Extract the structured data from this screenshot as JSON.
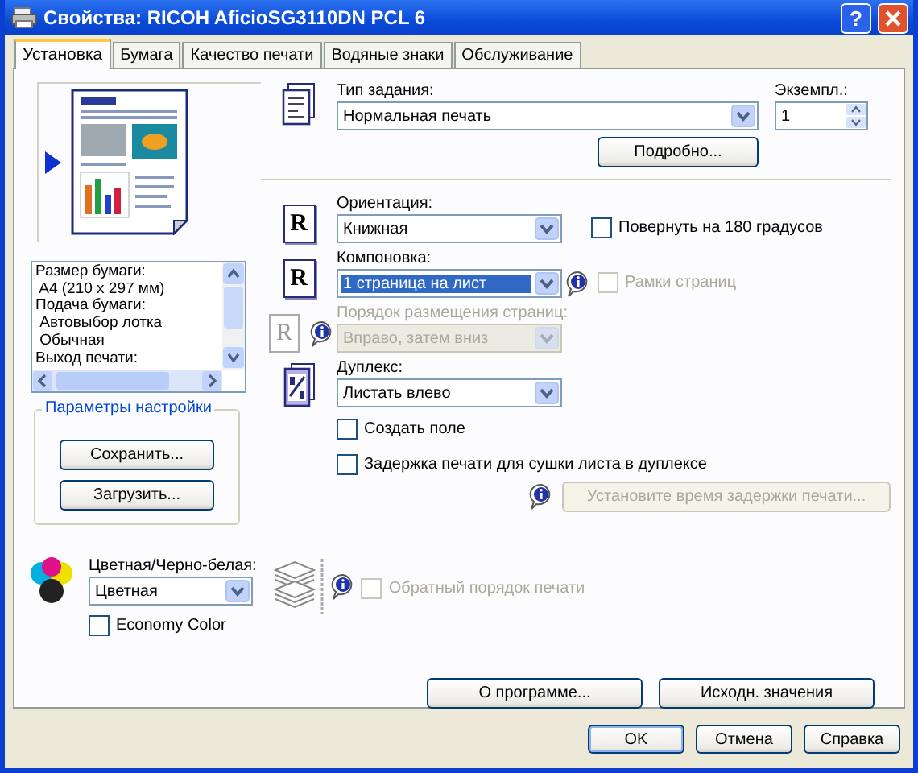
{
  "window": {
    "title": "Свойства: RICOH AficioSG3110DN PCL 6",
    "help_button": "?"
  },
  "tabs": [
    {
      "label": "Установка",
      "selected": true
    },
    {
      "label": "Бумага",
      "selected": false
    },
    {
      "label": "Качество печати",
      "selected": false
    },
    {
      "label": "Водяные знаки",
      "selected": false
    },
    {
      "label": "Обслуживание",
      "selected": false
    }
  ],
  "job_type": {
    "label": "Тип задания:",
    "value": "Нормальная печать"
  },
  "copies": {
    "label": "Экземпл.:",
    "value": "1"
  },
  "details_button": "Подробно...",
  "info_lines": [
    "Размер бумаги:",
    " A4 (210 x 297 мм)",
    "Подача бумаги:",
    " Автовыбор лотка",
    " Обычная",
    "Выход печати:"
  ],
  "orientation": {
    "icon_text": "R",
    "label": "Ориентация:",
    "value": "Книжная",
    "disabled": false,
    "focused": false
  },
  "rotate_180": {
    "label": "Повернуть на 180 градусов",
    "checked": false,
    "disabled": false
  },
  "layout": {
    "icon_text": "R",
    "label": "Компоновка:",
    "value": "1 страница на лист",
    "disabled": false,
    "focused": true
  },
  "page_borders": {
    "label": "Рамки страниц",
    "checked": false,
    "disabled": true
  },
  "page_order": {
    "icon_text": "R",
    "label": "Порядок размещения страниц:",
    "value": "Вправо, затем вниз",
    "disabled": true,
    "focused": false
  },
  "duplex": {
    "label": "Дуплекс:",
    "value": "Листать влево",
    "disabled": false,
    "focused": false
  },
  "create_margin": {
    "label": "Создать поле",
    "checked": false,
    "disabled": false
  },
  "drying_delay": {
    "label": "Задержка печати для сушки листа в дуплексе",
    "checked": false,
    "disabled": false
  },
  "settings_group": {
    "title": "Параметры настройки",
    "buttons": [
      "Сохранить...",
      "Загрузить..."
    ]
  },
  "delay_button": {
    "label": "Установите время задержки печати...",
    "disabled": true
  },
  "color_mode": {
    "label": "Цветная/Черно-белая:",
    "value": "Цветная",
    "disabled": false,
    "focused": false
  },
  "economy_color": {
    "label": "Economy Color",
    "checked": false,
    "disabled": false
  },
  "reverse_order": {
    "label": "Обратный порядок печати",
    "checked": false,
    "disabled": true
  },
  "action_buttons": [
    "О программе...",
    "Исходн. значения"
  ],
  "dialog_buttons": [
    {
      "label": "OK",
      "default": true
    },
    {
      "label": "Отмена",
      "default": false
    },
    {
      "label": "Справка",
      "default": false
    }
  ]
}
